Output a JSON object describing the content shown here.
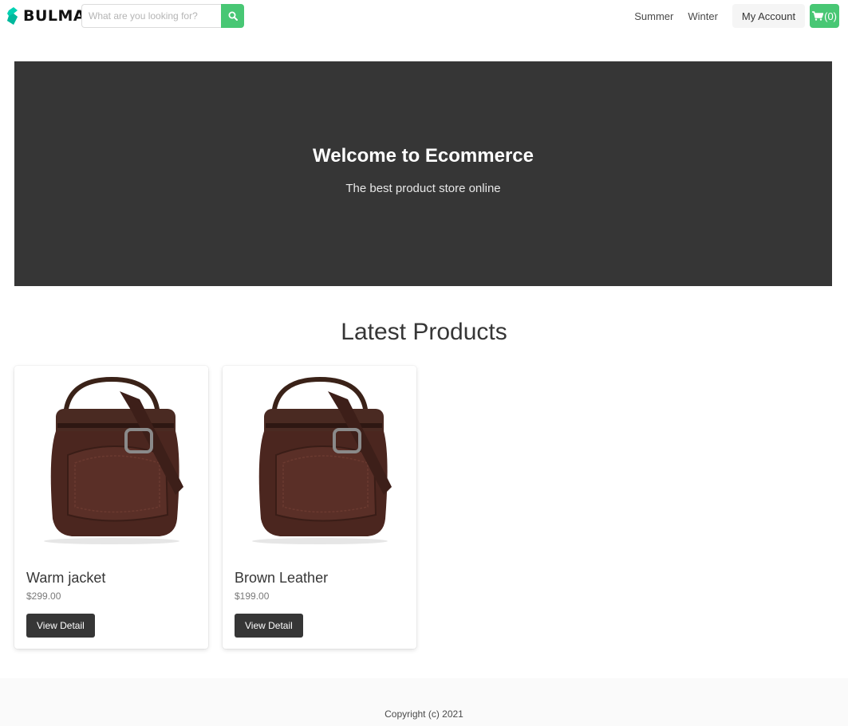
{
  "navbar": {
    "brand": "BULMA",
    "search": {
      "placeholder": "What are you looking for?",
      "value": ""
    },
    "links": [
      "Summer",
      "Winter"
    ],
    "account_label": "My Account",
    "cart_label": "(0)"
  },
  "hero": {
    "title": "Welcome to Ecommerce",
    "subtitle": "The best product store online"
  },
  "products_section": {
    "title": "Latest Products",
    "products": [
      {
        "name": "Warm jacket",
        "price": "$299.00",
        "button": "View Detail"
      },
      {
        "name": "Brown Leather",
        "price": "$199.00",
        "button": "View Detail"
      }
    ]
  },
  "footer": {
    "copyright": "Copyright (c) 2021"
  },
  "colors": {
    "accent": "#48c774",
    "brand": "#00d1b2",
    "dark": "#363636"
  },
  "icons": {
    "search": "search-icon",
    "cart": "shopping-cart-icon",
    "brand": "bulma-logo-icon"
  }
}
